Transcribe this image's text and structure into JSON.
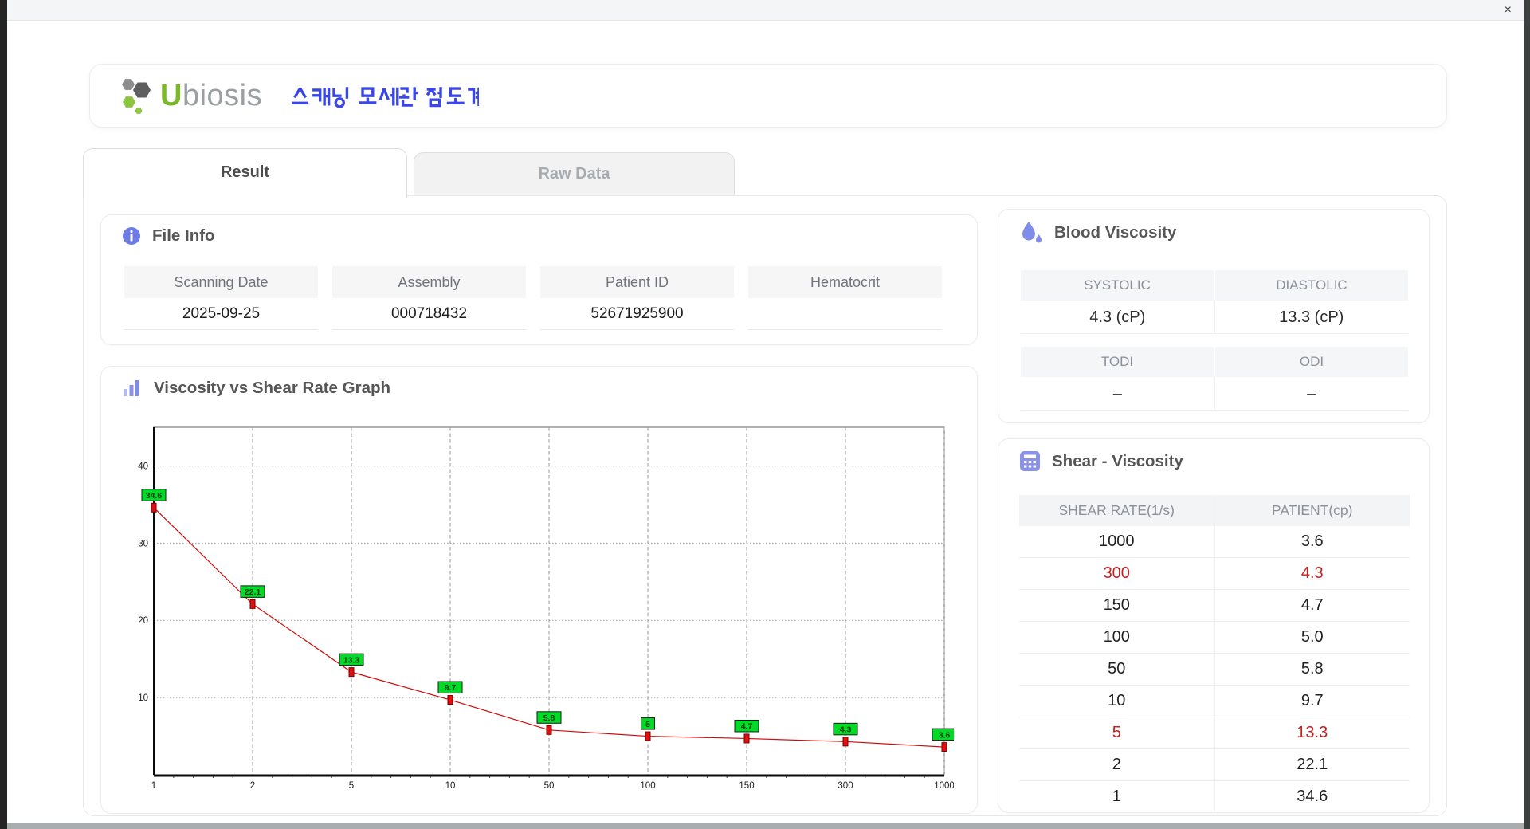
{
  "window": {
    "title_bar": {
      "close_label": "×"
    }
  },
  "header": {
    "brand": {
      "prefix": "U",
      "rest": "biosis"
    },
    "app_title_korean": "스캐닝 모세관 점도계",
    "accent_blue": "#3a47e6",
    "brand_green": "#7db829",
    "brand_gray": "#9aa0a2"
  },
  "tabs": {
    "result": "Result",
    "raw_data": "Raw Data"
  },
  "file_info": {
    "title": "File Info",
    "fields": [
      {
        "label": "Scanning Date",
        "value": "2025-09-25"
      },
      {
        "label": "Assembly",
        "value": "000718432"
      },
      {
        "label": "Patient ID",
        "value": "52671925900"
      },
      {
        "label": "Hematocrit",
        "value": ""
      }
    ]
  },
  "graph": {
    "title": "Viscosity vs Shear Rate Graph"
  },
  "chart_data": {
    "type": "line",
    "title": "Viscosity vs Shear Rate Graph",
    "x_axis_type": "category",
    "categories": [
      "1",
      "2",
      "5",
      "10",
      "50",
      "100",
      "150",
      "300",
      "1000"
    ],
    "series": [
      {
        "name": "PATIENT",
        "values": [
          34.6,
          22.1,
          13.3,
          9.7,
          5.8,
          5.0,
          4.7,
          4.3,
          3.6
        ]
      }
    ],
    "point_labels": [
      "34.6",
      "22.1",
      "13.3",
      "9.7",
      "5.8",
      "5",
      "4.7",
      "4.3",
      "3.6"
    ],
    "y_ticks": [
      10,
      20,
      30,
      40
    ],
    "ylim": [
      0,
      45
    ],
    "grid": true,
    "legend": false,
    "line_color": "#cf0a0a",
    "marker_color": "#e01010",
    "point_label_bg": "#00dc26"
  },
  "blood_viscosity": {
    "title": "Blood Viscosity",
    "row1": {
      "headers": [
        "SYSTOLIC",
        "DIASTOLIC"
      ],
      "values": [
        "4.3 (cP)",
        "13.3 (cP)"
      ]
    },
    "row2": {
      "headers": [
        "TODI",
        "ODI"
      ],
      "values": [
        "–",
        "–"
      ]
    }
  },
  "shear_viscosity": {
    "title": "Shear - Viscosity",
    "columns": [
      "SHEAR RATE(1/s)",
      "PATIENT(cp)"
    ],
    "rows": [
      {
        "rate": "1000",
        "patient": "3.6",
        "highlight": false
      },
      {
        "rate": "300",
        "patient": "4.3",
        "highlight": true
      },
      {
        "rate": "150",
        "patient": "4.7",
        "highlight": false
      },
      {
        "rate": "100",
        "patient": "5.0",
        "highlight": false
      },
      {
        "rate": "50",
        "patient": "5.8",
        "highlight": false
      },
      {
        "rate": "10",
        "patient": "9.7",
        "highlight": false
      },
      {
        "rate": "5",
        "patient": "13.3",
        "highlight": true
      },
      {
        "rate": "2",
        "patient": "22.1",
        "highlight": false
      },
      {
        "rate": "1",
        "patient": "34.6",
        "highlight": false
      }
    ],
    "highlight_color": "#c81e1e"
  }
}
